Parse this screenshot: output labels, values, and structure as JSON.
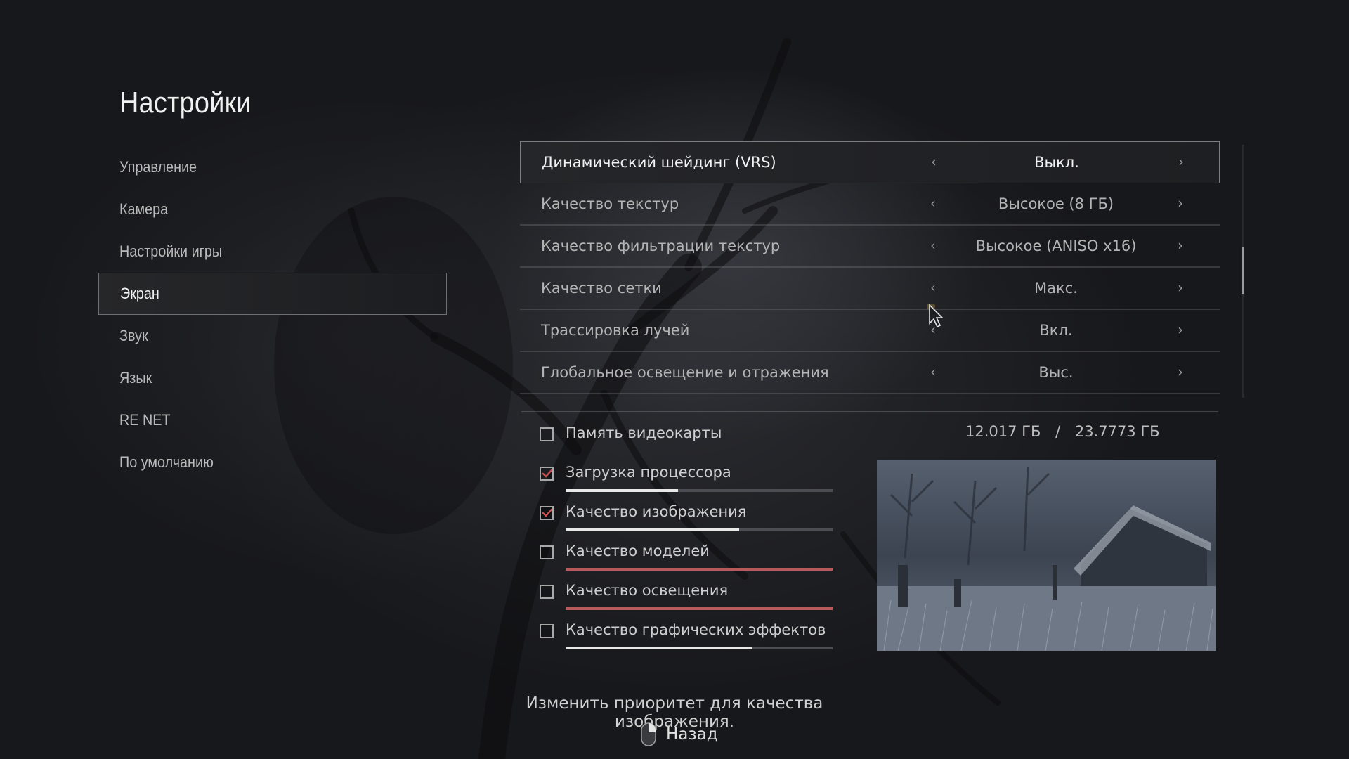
{
  "page": {
    "title": "Настройки"
  },
  "nav": {
    "items": [
      {
        "label": "Управление"
      },
      {
        "label": "Камера"
      },
      {
        "label": "Настройки игры"
      },
      {
        "label": "Экран",
        "active": true
      },
      {
        "label": "Звук"
      },
      {
        "label": "Язык"
      },
      {
        "label": "RE NET"
      },
      {
        "label": "По умолчанию"
      }
    ]
  },
  "settings": [
    {
      "label": "Динамический шейдинг (VRS)",
      "value": "Выкл.",
      "active": true
    },
    {
      "label": "Качество текстур",
      "value": "Высокое (8 ГБ)"
    },
    {
      "label": "Качество фильтрации текстур",
      "value": "Высокое (ANISO x16)"
    },
    {
      "label": "Качество сетки",
      "value": "Макс."
    },
    {
      "label": "Трассировка лучей",
      "value": "Вкл."
    },
    {
      "label": "Глобальное освещение и отражения",
      "value": "Выс."
    }
  ],
  "vram": {
    "label": "Память видеокарты",
    "used": "12.017 ГБ",
    "separator": "/",
    "total": "23.7773 ГБ",
    "checked": false
  },
  "priorities": [
    {
      "label": "Загрузка процессора",
      "checked": true,
      "level": 0.42,
      "color": "#e8e8e8"
    },
    {
      "label": "Качество изображения",
      "checked": true,
      "level": 0.65,
      "color": "#e8e8e8"
    },
    {
      "label": "Качество моделей",
      "checked": false,
      "level": 1.0,
      "color": "#b95a5a"
    },
    {
      "label": "Качество освещения",
      "checked": false,
      "level": 1.0,
      "color": "#b95a5a"
    },
    {
      "label": "Качество графических эффектов",
      "checked": false,
      "level": 0.7,
      "color": "#e8e8e8"
    }
  ],
  "colors": {
    "check_mark": "#d05050",
    "accent_red": "#b95a5a"
  },
  "footer": {
    "hint": "Изменить приоритет для качества изображения.",
    "back_label": "Назад",
    "back_icon": "mouse-icon"
  }
}
